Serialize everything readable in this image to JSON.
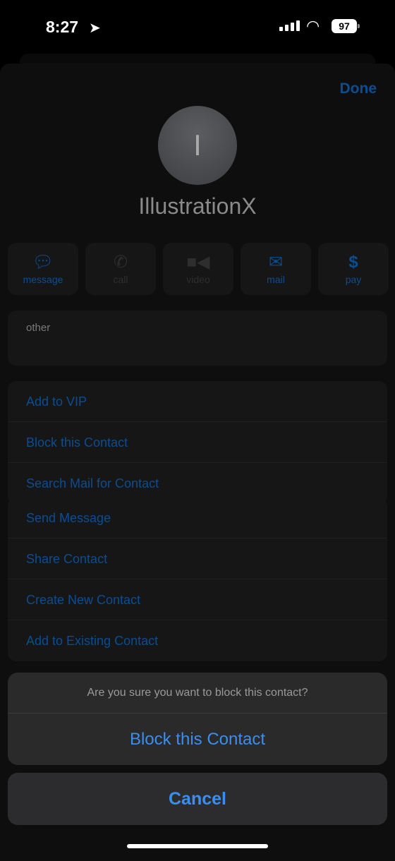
{
  "status": {
    "time": "8:27",
    "battery": "97"
  },
  "header": {
    "done": "Done"
  },
  "contact": {
    "initial": "I",
    "name": "IllustrationX"
  },
  "actions": [
    {
      "label": "message",
      "icon": "message-bubble-icon",
      "enabled": true
    },
    {
      "label": "call",
      "icon": "phone-icon",
      "enabled": false
    },
    {
      "label": "video",
      "icon": "video-camera-icon",
      "enabled": false
    },
    {
      "label": "mail",
      "icon": "envelope-icon",
      "enabled": true
    },
    {
      "label": "pay",
      "icon": "dollar-icon",
      "enabled": true
    }
  ],
  "info": {
    "label": "other"
  },
  "group1": [
    "Add to VIP",
    "Block this Contact",
    "Search Mail for Contact"
  ],
  "group2": [
    "Send Message",
    "Share Contact",
    "Create New Contact",
    "Add to Existing Contact"
  ],
  "alert": {
    "question": "Are you sure you want to block this contact?",
    "confirm": "Block this Contact",
    "cancel": "Cancel"
  },
  "colors": {
    "accent": "#3b8ef0",
    "dimmed_accent": "#0a4d92"
  }
}
